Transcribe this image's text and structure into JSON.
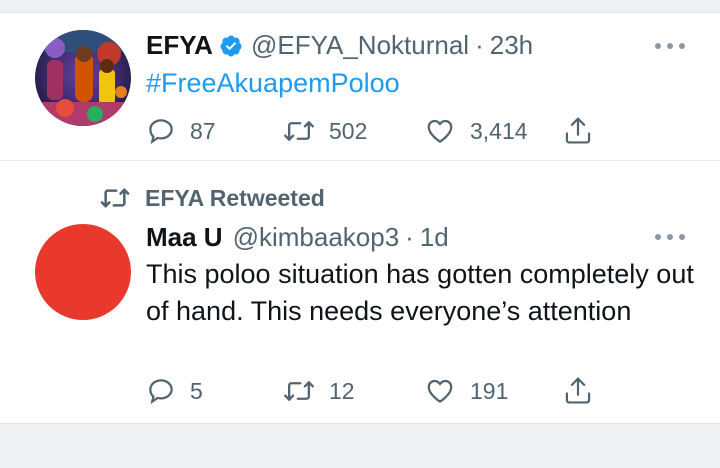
{
  "tweet1": {
    "name": "EFYA",
    "handle": "@EFYA_Nokturnal",
    "separator": "·",
    "time": "23h",
    "text": "#FreeAkuapemPoloo",
    "replies": "87",
    "retweets": "502",
    "likes": "3,414",
    "verified": true
  },
  "retweet_label": "EFYA Retweeted",
  "tweet2": {
    "name": "Maa U",
    "handle": "@kimbaakop3",
    "separator": "·",
    "time": "1d",
    "text": "This poloo situation has gotten completely out of hand. This needs everyone’s attention",
    "replies": "5",
    "retweets": "12",
    "likes": "191",
    "avatar_color": "#e8392c"
  },
  "colors": {
    "link": "#1d9bf0",
    "verified_badge": "#1d9bf0",
    "secondary_text": "#536471"
  },
  "icons": [
    "reply-icon",
    "retweet-icon",
    "like-icon",
    "share-icon",
    "more-icon",
    "verified-icon"
  ]
}
